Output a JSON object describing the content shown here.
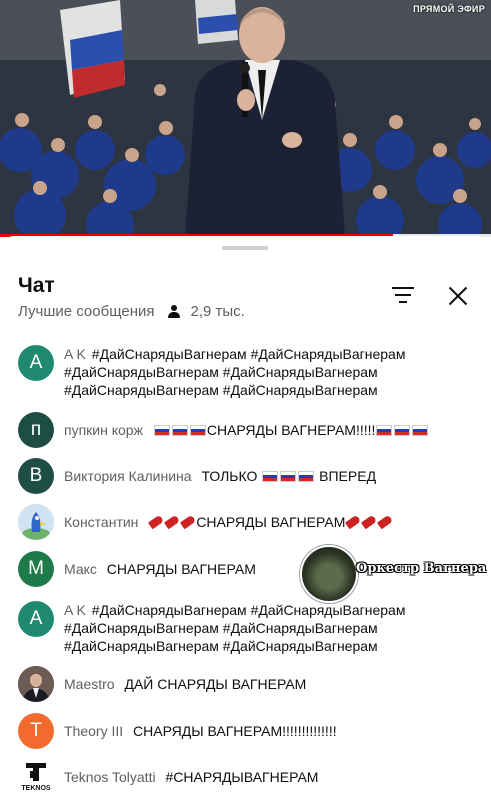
{
  "video": {
    "live_label": "ПРЯМОЙ ЭФИР",
    "progress": 0.8,
    "flag_colors": [
      "#ffffff",
      "#1c3fb8",
      "#d52b1e"
    ]
  },
  "chat": {
    "title": "Чат",
    "mode": "Лучшие сообщения",
    "viewers": "2,9 тыс.",
    "filter_icon": "filter-icon",
    "close_icon": "close-icon"
  },
  "messages": [
    {
      "avatar_letter": "A",
      "avatar_color": "#1f8a70",
      "author": "A K",
      "text": "#ДайСнарядыВагнерам #ДайСнарядыВагнерам #ДайСнарядыВагнерам #ДайСнарядыВагнерам #ДайСнарядыВагнерам #ДайСнарядыВагнерам"
    },
    {
      "avatar_letter": "п",
      "avatar_color": "#1e4d44",
      "author": "пупкин корж",
      "text_after": "СНАРЯДЫ ВАГНЕРАМ!!!!!"
    },
    {
      "avatar_letter": "В",
      "avatar_color": "#1e4d44",
      "author": "Виктория Калинина",
      "text_before": "ТОЛЬКО",
      "text_after": "ВПЕРЕД"
    },
    {
      "avatar_letter": "",
      "avatar_color": "#cfe3f2",
      "author": "Константин",
      "text": "СНАРЯДЫ ВАГНЕРАМ"
    },
    {
      "avatar_letter": "M",
      "avatar_color": "#1f7a4a",
      "author": "Макс",
      "text": "СНАРЯДЫ ВАГНЕРАМ",
      "sticker_text": "Оркестр Вагнера"
    },
    {
      "avatar_letter": "A",
      "avatar_color": "#1f8a70",
      "author": "A K",
      "text": "#ДайСнарядыВагнерам #ДайСнарядыВагнерам #ДайСнарядыВагнерам #ДайСнарядыВагнерам #ДайСнарядыВагнерам #ДайСнарядыВагнерам"
    },
    {
      "avatar_letter": "",
      "avatar_color": "#5a4a44",
      "author": "Maestro",
      "text": "ДАЙ СНАРЯДЫ ВАГНЕРАМ"
    },
    {
      "avatar_letter": "T",
      "avatar_color": "#f26a2e",
      "author": "Theory III",
      "text": "СНАРЯДЫ ВАГНЕРАМ!!!!!!!!!!!!!!"
    },
    {
      "avatar_letter": "",
      "avatar_color": "#ffffff",
      "author": "Teknos Tolyatti",
      "text": "#СНАРЯДЫВАГНЕРАМ",
      "logo_text": "TEKNOS"
    }
  ]
}
